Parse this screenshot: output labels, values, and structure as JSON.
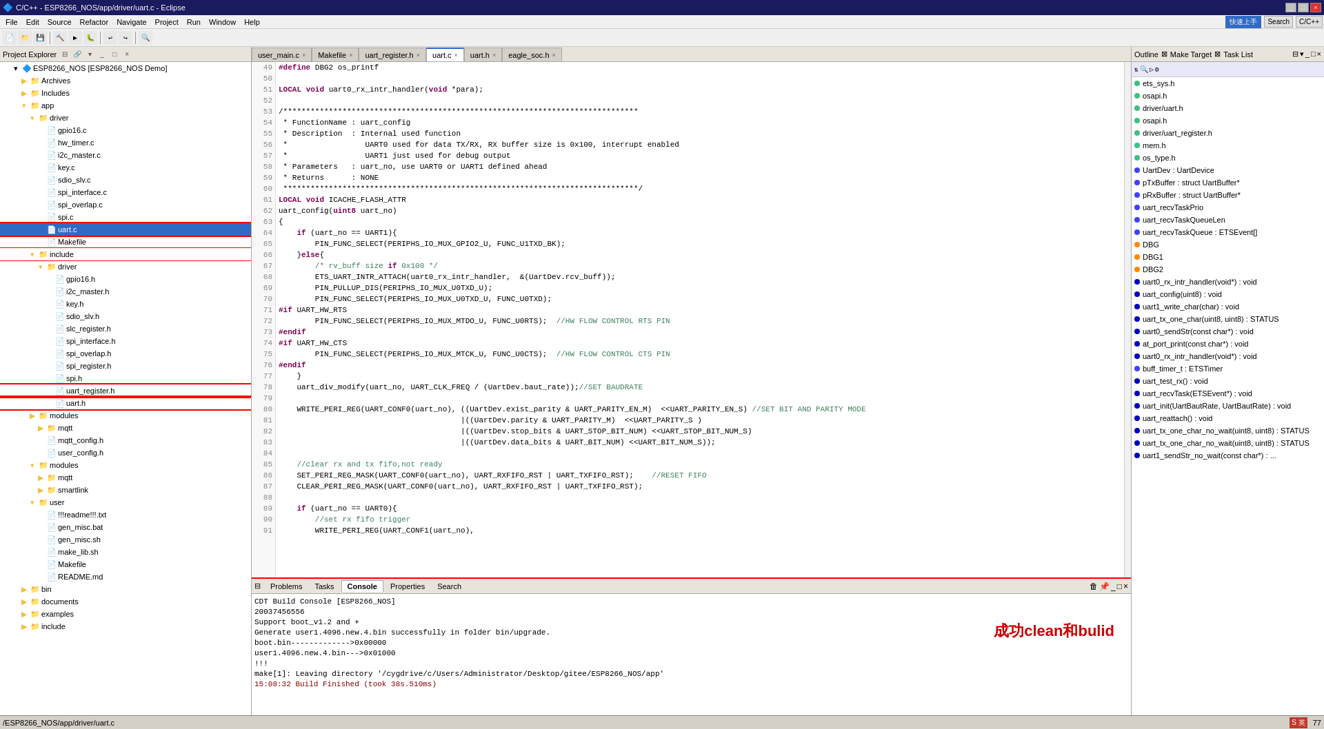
{
  "titleBar": {
    "title": "C/C++ - ESP8266_NOS/app/driver/uart.c - Eclipse",
    "buttons": [
      "_",
      "□",
      "×"
    ]
  },
  "menuBar": {
    "items": [
      "File",
      "Edit",
      "Source",
      "Refactor",
      "Navigate",
      "Project",
      "Run",
      "Window",
      "Help"
    ]
  },
  "toolbar": {
    "quickAccessLabel": "快速上手",
    "perspectiveLabel": "C/C++"
  },
  "leftPanel": {
    "title": "Project Explorer",
    "tree": [
      {
        "level": 1,
        "label": "ESP8266_NOS [ESP8266_NOS Demo]",
        "type": "project",
        "expanded": true
      },
      {
        "level": 2,
        "label": "Archives",
        "type": "folder"
      },
      {
        "level": 2,
        "label": "Includes",
        "type": "folder",
        "expanded": true
      },
      {
        "level": 2,
        "label": "app",
        "type": "folder",
        "expanded": true
      },
      {
        "level": 3,
        "label": "driver",
        "type": "folder",
        "expanded": true
      },
      {
        "level": 4,
        "label": "gpio16.c",
        "type": "c-file"
      },
      {
        "level": 4,
        "label": "hw_timer.c",
        "type": "c-file"
      },
      {
        "level": 4,
        "label": "i2c_master.c",
        "type": "c-file"
      },
      {
        "level": 4,
        "label": "key.c",
        "type": "c-file"
      },
      {
        "level": 4,
        "label": "sdio_slv.c",
        "type": "c-file"
      },
      {
        "level": 4,
        "label": "spi_interface.c",
        "type": "c-file"
      },
      {
        "level": 4,
        "label": "spi_overlap.c",
        "type": "c-file"
      },
      {
        "level": 4,
        "label": "spi.c",
        "type": "c-file"
      },
      {
        "level": 4,
        "label": "uart.c",
        "type": "c-file",
        "highlighted": true,
        "selected": true
      },
      {
        "level": 4,
        "label": "Makefile",
        "type": "file"
      },
      {
        "level": 3,
        "label": "include",
        "type": "folder",
        "expanded": true
      },
      {
        "level": 4,
        "label": "driver",
        "type": "folder",
        "expanded": true
      },
      {
        "level": 5,
        "label": "gpio16.h",
        "type": "h-file"
      },
      {
        "level": 5,
        "label": "i2c_master.h",
        "type": "h-file"
      },
      {
        "level": 5,
        "label": "key.h",
        "type": "h-file"
      },
      {
        "level": 5,
        "label": "sdio_slv.h",
        "type": "h-file"
      },
      {
        "level": 5,
        "label": "slc_register.h",
        "type": "h-file"
      },
      {
        "level": 5,
        "label": "spi_interface.h",
        "type": "h-file"
      },
      {
        "level": 5,
        "label": "spi_overlap.h",
        "type": "h-file"
      },
      {
        "level": 5,
        "label": "spi_register.h",
        "type": "h-file"
      },
      {
        "level": 5,
        "label": "spi.h",
        "type": "h-file"
      },
      {
        "level": 5,
        "label": "uart_register.h",
        "type": "h-file",
        "highlighted": true
      },
      {
        "level": 5,
        "label": "uart.h",
        "type": "h-file",
        "highlighted": true
      },
      {
        "level": 3,
        "label": "modules",
        "type": "folder"
      },
      {
        "level": 4,
        "label": "mqtt",
        "type": "folder"
      },
      {
        "level": 4,
        "label": "mqtt_config.h",
        "type": "h-file"
      },
      {
        "level": 4,
        "label": "user_config.h",
        "type": "h-file"
      },
      {
        "level": 3,
        "label": "modules",
        "type": "folder"
      },
      {
        "level": 4,
        "label": "mqtt",
        "type": "folder"
      },
      {
        "level": 4,
        "label": "smartlink",
        "type": "folder"
      },
      {
        "level": 3,
        "label": "user",
        "type": "folder"
      },
      {
        "level": 4,
        "label": "!!!readme!!!.txt",
        "type": "file"
      },
      {
        "level": 4,
        "label": "gen_misc.bat",
        "type": "file"
      },
      {
        "level": 4,
        "label": "gen_misc.sh",
        "type": "file"
      },
      {
        "level": 4,
        "label": "make_lib.sh",
        "type": "file"
      },
      {
        "level": 4,
        "label": "Makefile",
        "type": "file"
      },
      {
        "level": 4,
        "label": "README.md",
        "type": "file"
      },
      {
        "level": 2,
        "label": "bin",
        "type": "folder"
      },
      {
        "level": 2,
        "label": "documents",
        "type": "folder"
      },
      {
        "level": 2,
        "label": "examples",
        "type": "folder"
      },
      {
        "level": 2,
        "label": "include",
        "type": "folder"
      }
    ]
  },
  "editorTabs": [
    {
      "label": "user_main.c",
      "active": false
    },
    {
      "label": "Makefile",
      "active": false
    },
    {
      "label": "uart_register.h",
      "active": false
    },
    {
      "label": "uart.c",
      "active": true
    },
    {
      "label": "uart.h",
      "active": false
    },
    {
      "label": "eagle_soc.h",
      "active": false
    }
  ],
  "codeLines": [
    {
      "num": "49",
      "code": "#define DBG2 os_printf"
    },
    {
      "num": "50",
      "code": ""
    },
    {
      "num": "51",
      "code": "LOCAL void uart0_rx_intr_handler(void *para);"
    },
    {
      "num": "52",
      "code": ""
    },
    {
      "num": "53",
      "code": "/******************************************************************************"
    },
    {
      "num": "54",
      "code": " * FunctionName : uart_config"
    },
    {
      "num": "55",
      "code": " * Description  : Internal used function"
    },
    {
      "num": "56",
      "code": " *                 UART0 used for data TX/RX, RX buffer size is 0x100, interrupt enabled"
    },
    {
      "num": "57",
      "code": " *                 UART1 just used for debug output"
    },
    {
      "num": "58",
      "code": " * Parameters   : uart_no, use UART0 or UART1 defined ahead"
    },
    {
      "num": "59",
      "code": " * Returns      : NONE"
    },
    {
      "num": "60",
      "code": " ******************************************************************************/"
    },
    {
      "num": "61",
      "code": "LOCAL void ICACHE_FLASH_ATTR"
    },
    {
      "num": "62",
      "code": "uart_config(uint8 uart_no)"
    },
    {
      "num": "63",
      "code": "{"
    },
    {
      "num": "64",
      "code": "    if (uart_no == UART1){"
    },
    {
      "num": "65",
      "code": "        PIN_FUNC_SELECT(PERIPHS_IO_MUX_GPIO2_U, FUNC_U1TXD_BK);"
    },
    {
      "num": "66",
      "code": "    }else{"
    },
    {
      "num": "67",
      "code": "        /* rv_buff size if 0x100 */"
    },
    {
      "num": "68",
      "code": "        ETS_UART_INTR_ATTACH(uart0_rx_intr_handler,  &(UartDev.rcv_buff));"
    },
    {
      "num": "69",
      "code": "        PIN_PULLUP_DIS(PERIPHS_IO_MUX_U0TXD_U);"
    },
    {
      "num": "70",
      "code": "        PIN_FUNC_SELECT(PERIPHS_IO_MUX_U0TXD_U, FUNC_U0TXD);"
    },
    {
      "num": "71",
      "code": "#if UART_HW_RTS"
    },
    {
      "num": "72",
      "code": "        PIN_FUNC_SELECT(PERIPHS_IO_MUX_MTDO_U, FUNC_U0RTS);  //HW FLOW CONTROL RTS PIN"
    },
    {
      "num": "73",
      "code": "#endif"
    },
    {
      "num": "74",
      "code": "#if UART_HW_CTS"
    },
    {
      "num": "75",
      "code": "        PIN_FUNC_SELECT(PERIPHS_IO_MUX_MTCK_U, FUNC_U0CTS);  //HW FLOW CONTROL CTS PIN"
    },
    {
      "num": "76",
      "code": "#endif"
    },
    {
      "num": "77",
      "code": "    }"
    },
    {
      "num": "78",
      "code": "    uart_div_modify(uart_no, UART_CLK_FREQ / (UartDev.baut_rate));//SET BAUDRATE"
    },
    {
      "num": "79",
      "code": ""
    },
    {
      "num": "80",
      "code": "    WRITE_PERI_REG(UART_CONF0(uart_no), ((UartDev.exist_parity & UART_PARITY_EN_M)  <<UART_PARITY_EN_S) //SET BIT AND PARITY MODE"
    },
    {
      "num": "81",
      "code": "                                        |((UartDev.parity & UART_PARITY_M)  <<UART_PARITY_S )"
    },
    {
      "num": "82",
      "code": "                                        |((UartDev.stop_bits & UART_STOP_BIT_NUM) <<UART_STOP_BIT_NUM_S)"
    },
    {
      "num": "83",
      "code": "                                        |((UartDev.data_bits & UART_BIT_NUM) <<UART_BIT_NUM_S));"
    },
    {
      "num": "84",
      "code": ""
    },
    {
      "num": "85",
      "code": "    //clear rx and tx fifo,not ready"
    },
    {
      "num": "86",
      "code": "    SET_PERI_REG_MASK(UART_CONF0(uart_no), UART_RXFIFO_RST | UART_TXFIFO_RST);    //RESET FIFO"
    },
    {
      "num": "87",
      "code": "    CLEAR_PERI_REG_MASK(UART_CONF0(uart_no), UART_RXFIFO_RST | UART_TXFIFO_RST);"
    },
    {
      "num": "88",
      "code": ""
    },
    {
      "num": "89",
      "code": "    if (uart_no == UART0){"
    },
    {
      "num": "90",
      "code": "        //set rx fifo trigger"
    },
    {
      "num": "91",
      "code": "        WRITE_PERI_REG(UART_CONF1(uart_no),"
    }
  ],
  "rightPanel": {
    "outlineTitle": "Outline",
    "makeTargetTitle": "Make Target",
    "taskListTitle": "Task List",
    "items": [
      {
        "label": "ets_sys.h",
        "type": "include"
      },
      {
        "label": "osapi.h",
        "type": "include"
      },
      {
        "label": "driver/uart.h",
        "type": "include"
      },
      {
        "label": "osapi.h",
        "type": "include"
      },
      {
        "label": "driver/uart_register.h",
        "type": "include"
      },
      {
        "label": "mem.h",
        "type": "include"
      },
      {
        "label": "os_type.h",
        "type": "include"
      },
      {
        "label": "UartDev : UartDevice",
        "type": "var"
      },
      {
        "label": "pTxBuffer : struct UartBuffer*",
        "type": "var"
      },
      {
        "label": "pRxBuffer : struct UartBuffer*",
        "type": "var"
      },
      {
        "label": "uart_recvTaskPrio",
        "type": "var"
      },
      {
        "label": "uart_recvTaskQueueLen",
        "type": "var"
      },
      {
        "label": "uart_recvTaskQueue : ETSEvent[]",
        "type": "var"
      },
      {
        "label": "DBG",
        "type": "define"
      },
      {
        "label": "DBG1",
        "type": "define"
      },
      {
        "label": "DBG2",
        "type": "define"
      },
      {
        "label": "uart0_rx_intr_handler(void*) : void",
        "type": "fn"
      },
      {
        "label": "uart_config(uint8) : void",
        "type": "fn"
      },
      {
        "label": "uart1_write_char(char) : void",
        "type": "fn"
      },
      {
        "label": "uart_tx_one_char(uint8, uint8) : STATUS",
        "type": "fn"
      },
      {
        "label": "uart0_sendStr(const char*) : void",
        "type": "fn"
      },
      {
        "label": "at_port_print(const char*) : void",
        "type": "fn"
      },
      {
        "label": "uart0_rx_intr_handler(void*) : void",
        "type": "fn"
      },
      {
        "label": "buff_timer_t : ETSTimer",
        "type": "var"
      },
      {
        "label": "uart_test_rx() : void",
        "type": "fn"
      },
      {
        "label": "uart_recvTask(ETSEvent*) : void",
        "type": "fn"
      },
      {
        "label": "uart_init(UartBautRate, UartBautRate) : void",
        "type": "fn"
      },
      {
        "label": "uart_reattach() : void",
        "type": "fn"
      },
      {
        "label": "uart_tx_one_char_no_wait(uint8, uint8) : STATUS",
        "type": "fn"
      },
      {
        "label": "uart_tx_one_char_no_wait(uint8, uint8) : STATUS",
        "type": "fn"
      },
      {
        "label": "uart1_sendStr_no_wait(const char*) : ...",
        "type": "fn"
      }
    ]
  },
  "bottomPanel": {
    "tabs": [
      "Problems",
      "Tasks",
      "Console",
      "Properties",
      "Search"
    ],
    "activeTab": "Console",
    "header": "CDT Build Console [ESP8266_NOS]",
    "lines": [
      "20037456556",
      "Support boot_v1.2 and +",
      "Generate user1.4096.new.4.bin successfully in folder bin/upgrade.",
      "boot.bin------------->0x00000",
      "user1.4096.new.4.bin--->0x01000",
      "!!!",
      "make[1]: Leaving directory '/cygdrive/c/Users/Administrator/Desktop/gitee/ESP8266_NOS/app'"
    ],
    "successText": "成功clean和bulid",
    "timestamp": "15:08:32 Build Finished (took 38s.510ms)"
  },
  "statusBar": {
    "path": "/ESP8266_NOS/app/driver/uart.c",
    "rightInfo": "77"
  }
}
